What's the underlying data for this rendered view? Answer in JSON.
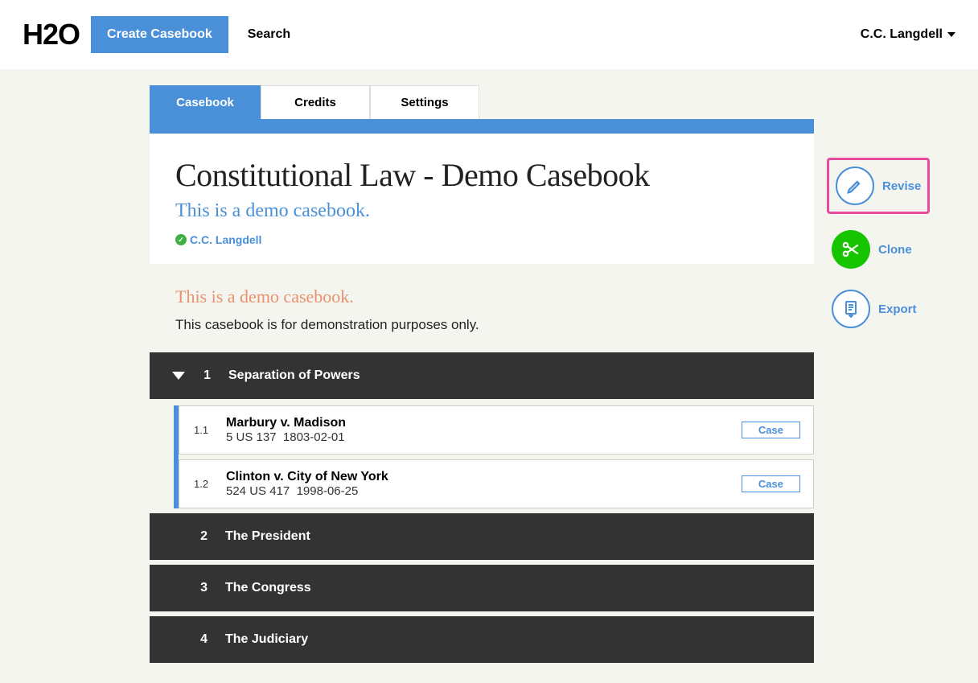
{
  "brand": "H2O",
  "create_button": "Create Casebook",
  "search_label": "Search",
  "user_name": "C.C. Langdell",
  "tabs": [
    {
      "label": "Casebook",
      "active": true
    },
    {
      "label": "Credits",
      "active": false
    },
    {
      "label": "Settings",
      "active": false
    }
  ],
  "title": "Constitutional Law - Demo Casebook",
  "subtitle": "This is a demo casebook.",
  "author": "C.C. Langdell",
  "headnote": "This is a demo casebook.",
  "description": "This casebook is for demonstration purposes only.",
  "sections": [
    {
      "num": "1",
      "title": "Separation of Powers",
      "expanded": true,
      "items": [
        {
          "num": "1.1",
          "title": "Marbury v. Madison",
          "cite": "5 US 137",
          "date": "1803-02-01",
          "badge": "Case"
        },
        {
          "num": "1.2",
          "title": "Clinton v. City of New York",
          "cite": "524 US 417",
          "date": "1998-06-25",
          "badge": "Case"
        }
      ]
    },
    {
      "num": "2",
      "title": "The President",
      "expanded": false,
      "items": []
    },
    {
      "num": "3",
      "title": "The Congress",
      "expanded": false,
      "items": []
    },
    {
      "num": "4",
      "title": "The Judiciary",
      "expanded": false,
      "items": []
    }
  ],
  "actions": [
    {
      "key": "revise",
      "label": "Revise",
      "highlight": true,
      "icon": "pencil",
      "style": "outline"
    },
    {
      "key": "clone",
      "label": "Clone",
      "highlight": false,
      "icon": "scissors",
      "style": "filled"
    },
    {
      "key": "export",
      "label": "Export",
      "highlight": false,
      "icon": "export",
      "style": "outline"
    }
  ]
}
